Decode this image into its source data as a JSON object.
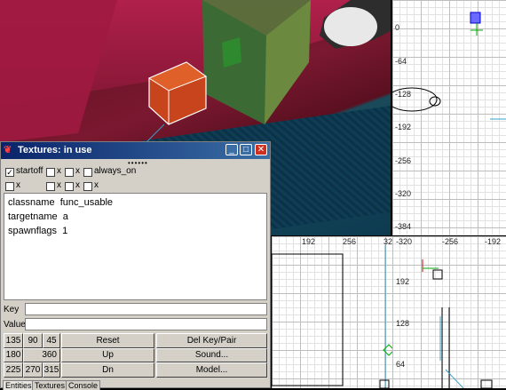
{
  "window": {
    "title": "Textures: in use",
    "minimize_glyph": "_",
    "maximize_glyph": "□",
    "close_glyph": "✕"
  },
  "spawnflag_checkboxes": [
    {
      "label": "startoff",
      "checked": true
    },
    {
      "label": "x",
      "checked": false
    },
    {
      "label": "x",
      "checked": false
    },
    {
      "label": "always_on",
      "checked": false
    },
    {
      "label": "x",
      "checked": false
    },
    {
      "label": "x",
      "checked": false
    },
    {
      "label": "x",
      "checked": false
    },
    {
      "label": "x",
      "checked": false
    }
  ],
  "properties": [
    {
      "key": "classname",
      "value": "func_usable"
    },
    {
      "key": "targetname",
      "value": "a"
    },
    {
      "key": "spawnflags",
      "value": "1"
    }
  ],
  "fields": {
    "key_label": "Key",
    "value_label": "Value",
    "key_value": "",
    "value_value": ""
  },
  "angle_buttons": [
    "135",
    "90",
    "45",
    "180",
    "360",
    "225",
    "270",
    "315"
  ],
  "action_buttons": {
    "reset": "Reset",
    "up": "Up",
    "dn": "Dn",
    "del_key_pair": "Del Key/Pair",
    "sound": "Sound...",
    "model": "Model..."
  },
  "tabs": [
    "Entities",
    "Textures",
    "Console"
  ],
  "grid_top": {
    "labels": [
      "0",
      "-64",
      "-128",
      "-192",
      "-256",
      "-320",
      "-384"
    ]
  },
  "grid_front": {
    "labels": [
      "192",
      "256",
      "32"
    ]
  },
  "grid_side": {
    "labels": [
      "-320",
      "-256",
      "-192",
      "192",
      "128",
      "64"
    ]
  },
  "colors": {
    "titlebar": "#0a246a",
    "window_face": "#d4d0c8",
    "grid_bg": "#ffffff"
  }
}
